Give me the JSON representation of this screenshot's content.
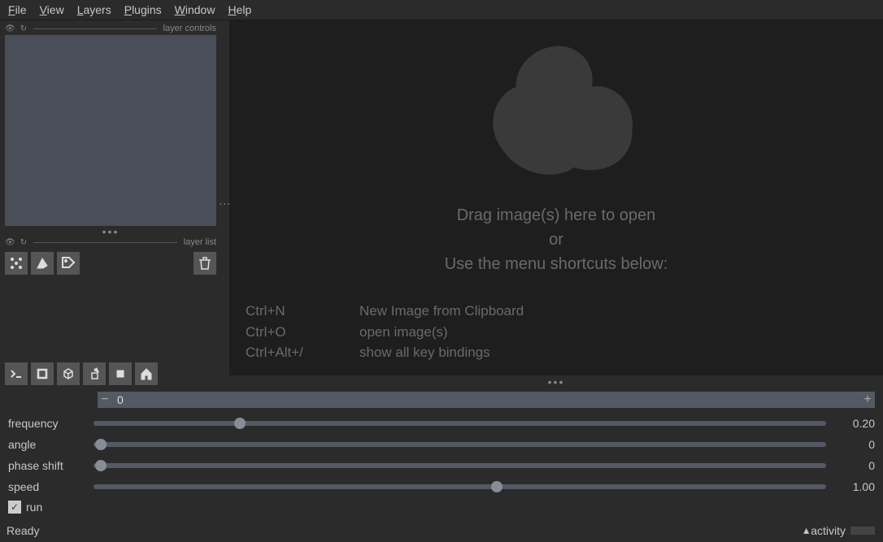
{
  "menu": {
    "items": [
      {
        "ul": "F",
        "rest": "ile"
      },
      {
        "ul": "V",
        "rest": "iew"
      },
      {
        "ul": "L",
        "rest": "ayers"
      },
      {
        "ul": "P",
        "rest": "lugins"
      },
      {
        "ul": "W",
        "rest": "indow"
      },
      {
        "ul": "H",
        "rest": "elp"
      }
    ]
  },
  "sections": {
    "layer_controls": "layer controls",
    "layer_list": "layer list"
  },
  "canvas": {
    "drag_msg": "Drag image(s) here to open",
    "or": "or",
    "menu_msg": "Use the menu shortcuts below:",
    "shortcuts": [
      {
        "key": "Ctrl+N",
        "desc": "New Image from Clipboard"
      },
      {
        "key": "Ctrl+O",
        "desc": "open image(s)"
      },
      {
        "key": "Ctrl+Alt+/",
        "desc": "show all key bindings"
      }
    ]
  },
  "stepper": {
    "minus": "−",
    "value": "0",
    "plus": "+"
  },
  "sliders": [
    {
      "label": "frequency",
      "value": "0.20",
      "pos": 20
    },
    {
      "label": "angle",
      "value": "0",
      "pos": 1
    },
    {
      "label": "phase shift",
      "value": "0",
      "pos": 1
    },
    {
      "label": "speed",
      "value": "1.00",
      "pos": 55
    }
  ],
  "checkbox": {
    "run_label": "run",
    "checked": true
  },
  "status": {
    "ready": "Ready",
    "activity": "activity"
  }
}
